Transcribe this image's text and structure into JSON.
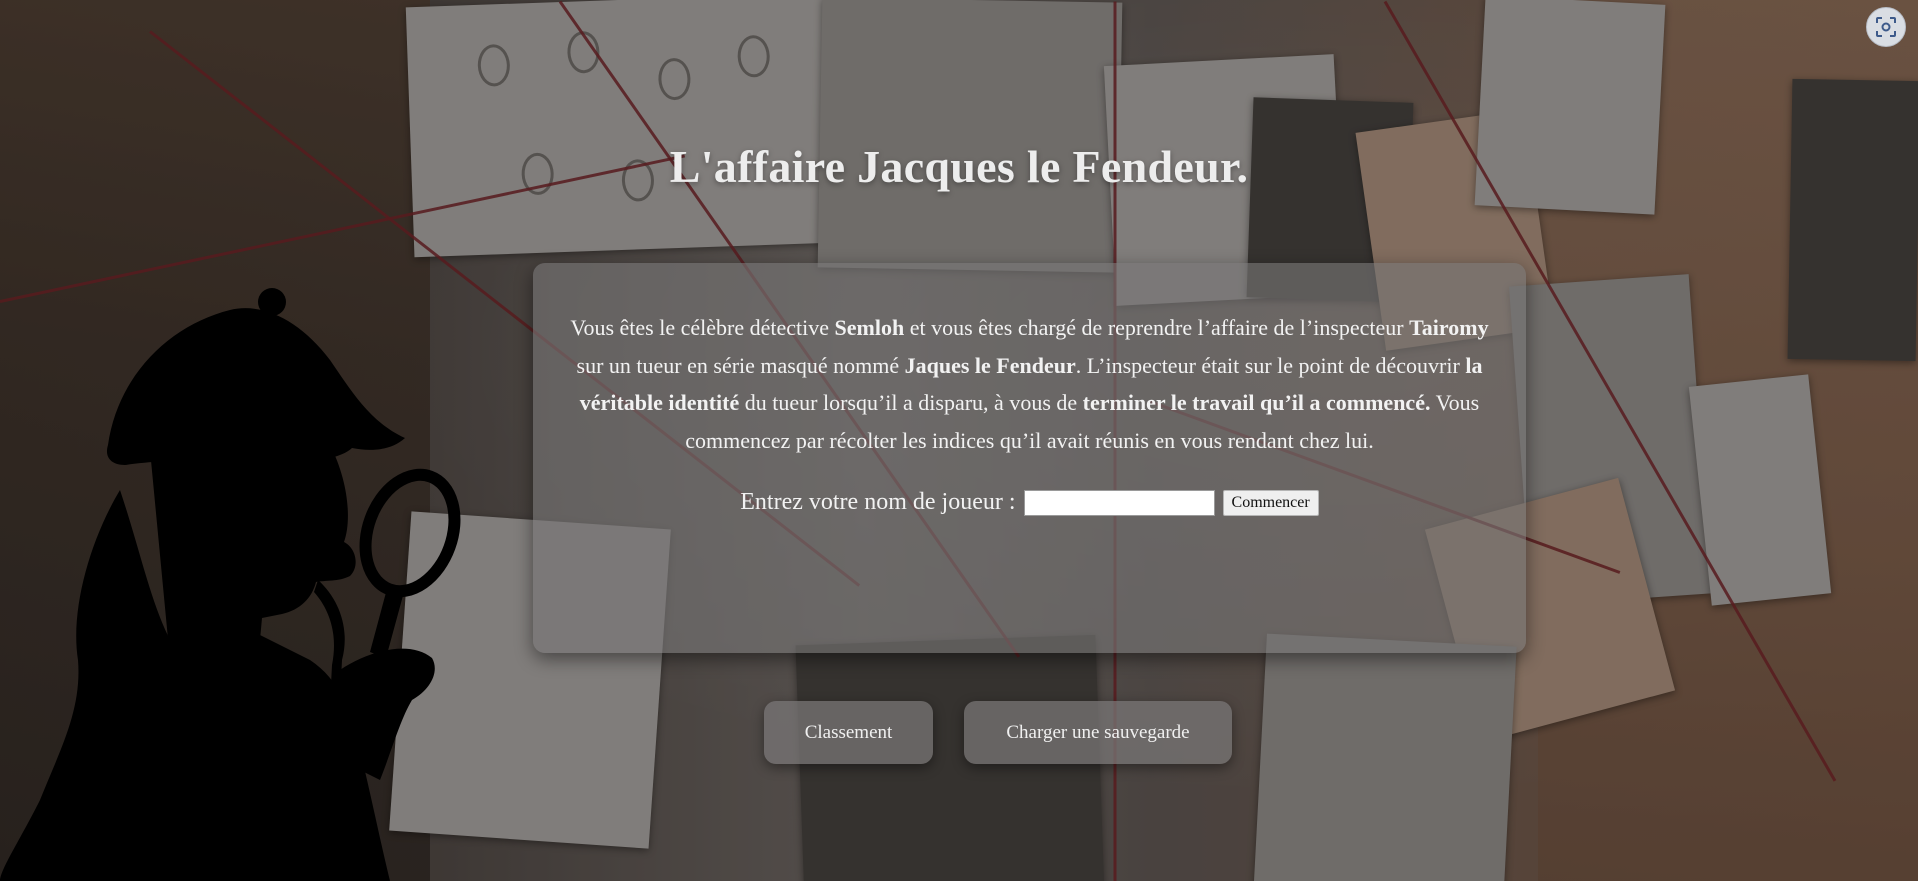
{
  "page": {
    "title": "L'affaire Jacques le Fendeur."
  },
  "intro": {
    "segments": [
      {
        "text": "Vous êtes le célèbre détective ",
        "bold": false
      },
      {
        "text": "Semloh",
        "bold": true
      },
      {
        "text": " et vous êtes chargé de reprendre l’affaire de l’inspecteur ",
        "bold": false
      },
      {
        "text": "Tairomy",
        "bold": true
      },
      {
        "text": " sur un tueur en série masqué nommé ",
        "bold": false
      },
      {
        "text": "Jaques le Fendeur",
        "bold": true
      },
      {
        "text": ". L’inspecteur était sur le point de découvrir ",
        "bold": false
      },
      {
        "text": "la véritable identité",
        "bold": true
      },
      {
        "text": " du tueur lorsqu’il a disparu, à vous de ",
        "bold": false
      },
      {
        "text": "terminer le travail qu’il a commencé.",
        "bold": true
      },
      {
        "text": " Vous commencez par récolter les indices qu’il avait réunis en vous rendant chez lui.",
        "bold": false
      }
    ]
  },
  "player": {
    "label": "Entrez votre nom de joueur :",
    "name_value": "",
    "name_placeholder": "",
    "start_label": "Commencer"
  },
  "actions": {
    "ranking_label": "Classement",
    "load_label": "Charger une sauvegarde"
  },
  "icons": {
    "corner": "screen-capture-icon",
    "detective": "detective-silhouette-icon"
  },
  "colors": {
    "card": "#787676",
    "text": "#f2f2f2",
    "string": "#6f1c22"
  }
}
